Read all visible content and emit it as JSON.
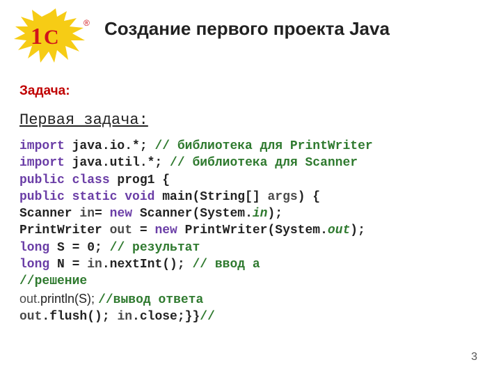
{
  "logo": {
    "one": "1",
    "c": "C",
    "reg": "®"
  },
  "title": "Создание первого проекта Java",
  "task_label": "Задача:",
  "subtitle": "Первая задача:",
  "code": {
    "l1": {
      "a": "import",
      "b": " java.io.*; ",
      "c": "// библиотека для PrintWriter"
    },
    "l2": {
      "a": "import",
      "b": " java.util.*; ",
      "c": "// библиотека для Scanner"
    },
    "l3": {
      "a": "public class",
      "b": " prog1 {"
    },
    "l4": {
      "a": "public static void",
      "b": " main(String[] ",
      "c": "args",
      "d": ") {"
    },
    "l5": {
      "a": "Scanner ",
      "b": "in",
      "c": "= ",
      "d": "new",
      "e": " Scanner(System.",
      "f": "in",
      "g": ");"
    },
    "l6": {
      "a": "PrintWriter ",
      "b": "out",
      "c": " = ",
      "d": "new",
      "e": " PrintWriter(System.",
      "f": "out",
      "g": ");"
    },
    "l7": {
      "a": "long",
      "b": " S = 0; ",
      "c": "// результат"
    },
    "l8": {
      "a": "long",
      "b": " N = ",
      "c": "in",
      "d": ".nextInt(); ",
      "e": "// ввод a"
    },
    "l9": {
      "a": "//решение"
    },
    "l10": {
      "a": "out.",
      "b": "println(S); ",
      "c": "//вывод ответа"
    },
    "l11": {
      "a": "out",
      "b": ".flush(); ",
      "c": "in",
      "d": ".close;}}",
      "e": "//"
    }
  },
  "page_number": "3"
}
